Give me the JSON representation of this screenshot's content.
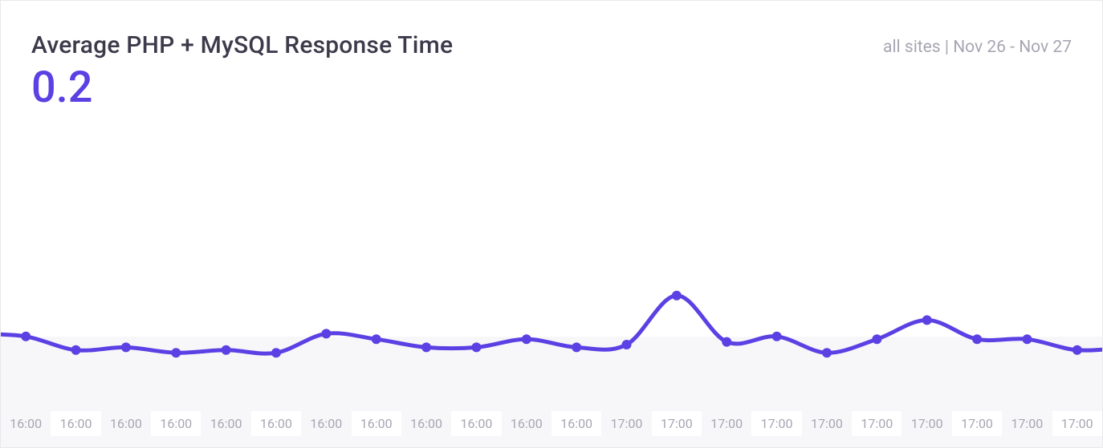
{
  "header": {
    "title": "Average PHP + MySQL Response Time",
    "meta": "all sites | Nov 26 - Nov 27"
  },
  "metric": {
    "value": "0.2"
  },
  "colors": {
    "accent": "#5b40e4",
    "text_muted": "#a7a6b3",
    "text_heading": "#3d3a4b",
    "fill": "#f7f7f9"
  },
  "chart_data": {
    "type": "line",
    "title": "Average PHP + MySQL Response Time",
    "xlabel": "",
    "ylabel": "",
    "ylim": [
      0,
      1.0
    ],
    "categories": [
      "16:00",
      "16:00",
      "16:00",
      "16:00",
      "16:00",
      "16:00",
      "16:00",
      "16:00",
      "16:00",
      "16:00",
      "16:00",
      "16:00",
      "17:00",
      "17:00",
      "17:00",
      "17:00",
      "17:00",
      "17:00",
      "17:00",
      "17:00",
      "17:00",
      "17:00"
    ],
    "values": [
      0.23,
      0.18,
      0.19,
      0.17,
      0.18,
      0.17,
      0.24,
      0.22,
      0.19,
      0.19,
      0.22,
      0.19,
      0.2,
      0.38,
      0.21,
      0.23,
      0.17,
      0.22,
      0.29,
      0.22,
      0.22,
      0.18
    ],
    "lead_in": 0.24,
    "lead_out": 0.19
  }
}
